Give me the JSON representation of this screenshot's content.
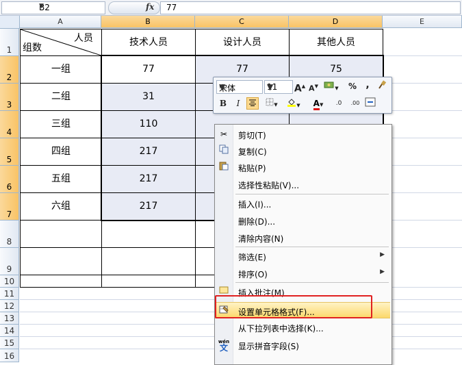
{
  "formula_bar": {
    "name_box": "B2",
    "fx_label": "fx",
    "value": "77"
  },
  "columns": [
    "A",
    "B",
    "C",
    "D",
    "E"
  ],
  "rows": [
    "1",
    "2",
    "3",
    "4",
    "5",
    "6",
    "7",
    "8",
    "9",
    "10",
    "11",
    "12",
    "13",
    "14",
    "15",
    "16"
  ],
  "table": {
    "header_corner_top": "人员",
    "header_corner_bottom": "组数",
    "headers": [
      "技术人员",
      "设计人员",
      "其他人员"
    ],
    "body": [
      {
        "group": "一组",
        "values": [
          "77",
          "77",
          "75"
        ]
      },
      {
        "group": "二组",
        "values": [
          "31",
          "",
          ""
        ]
      },
      {
        "group": "三组",
        "values": [
          "110",
          "",
          ""
        ]
      },
      {
        "group": "四组",
        "values": [
          "217",
          "",
          ""
        ]
      },
      {
        "group": "五组",
        "values": [
          "217",
          "",
          ""
        ]
      },
      {
        "group": "六组",
        "values": [
          "217",
          "",
          ""
        ]
      }
    ]
  },
  "mini_toolbar": {
    "font": "宋体",
    "size": "11",
    "grow_font": "A",
    "shrink_font": "A",
    "percent": "%",
    "comma": ",",
    "bold": "B",
    "italic": "I",
    "font_color": "A",
    "inc_decimal": ".0",
    "dec_decimal": ".00"
  },
  "context_menu": {
    "items": [
      {
        "label": "剪切(T)",
        "icon": "scissors-icon"
      },
      {
        "label": "复制(C)",
        "icon": "copy-icon"
      },
      {
        "label": "粘贴(P)",
        "icon": "paste-icon"
      },
      {
        "label": "选择性粘贴(V)...",
        "icon": ""
      },
      {
        "label": "插入(I)...",
        "icon": ""
      },
      {
        "label": "删除(D)...",
        "icon": ""
      },
      {
        "label": "清除内容(N)",
        "icon": ""
      },
      {
        "label": "筛选(E)",
        "icon": "",
        "submenu": true
      },
      {
        "label": "排序(O)",
        "icon": "",
        "submenu": true
      },
      {
        "label": "插入批注(M)",
        "icon": "comment-icon"
      },
      {
        "label": "设置单元格格式(F)...",
        "icon": "format-cells-icon",
        "highlighted": true
      },
      {
        "label": "从下拉列表中选择(K)...",
        "icon": ""
      },
      {
        "label": "显示拼音字段(S)",
        "icon": "phonetic-icon",
        "icon_text": "wén"
      }
    ]
  },
  "colors": {
    "highlight_border": "#e02020",
    "selection_fill": "#e8ebf5",
    "header_selected": "#f9c365"
  }
}
